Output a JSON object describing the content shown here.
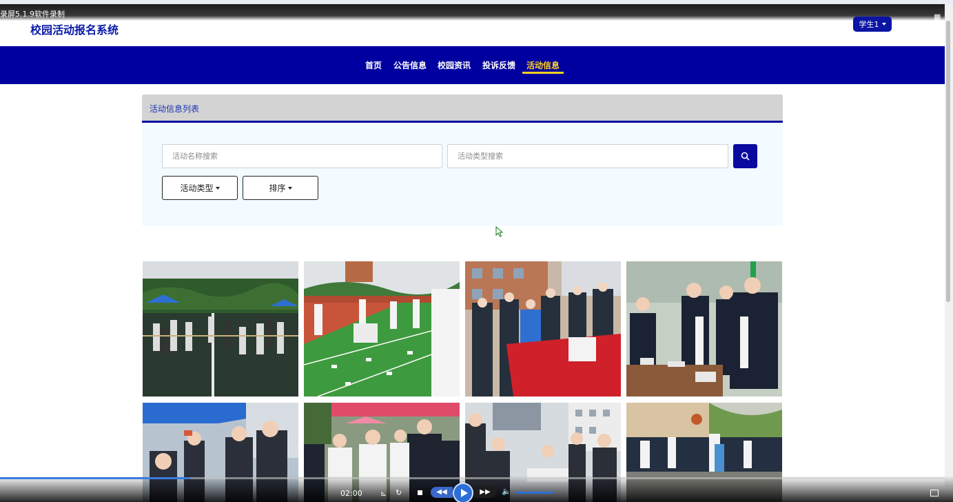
{
  "recorder": {
    "title": "录屏5.1.9软件录制",
    "time": "02:00"
  },
  "site": {
    "title": "校园活动报名系统"
  },
  "user_menu": {
    "label": "学生1"
  },
  "nav": {
    "items": [
      {
        "label": "首页"
      },
      {
        "label": "公告信息"
      },
      {
        "label": "校园资讯"
      },
      {
        "label": "投诉反馈"
      },
      {
        "label": "活动信息"
      }
    ],
    "active": "活动信息"
  },
  "list": {
    "header": "活动信息列表",
    "search_name_placeholder": "活动名称搜索",
    "search_type_placeholder": "活动类型搜索",
    "filter_type_label": "活动类型",
    "sort_label": "排序"
  },
  "colors": {
    "brand_blue": "#0000a0",
    "active_nav": "#ffd21e",
    "search_panel_bg": "#f2fbff"
  },
  "icons": [
    "search-icon",
    "caret-down-icon",
    "mouse-cursor-icon",
    "play-icon",
    "stop-icon",
    "rewind-icon",
    "fast-forward-icon",
    "volume-icon",
    "expand-icon"
  ],
  "playback_progress": 0.2
}
